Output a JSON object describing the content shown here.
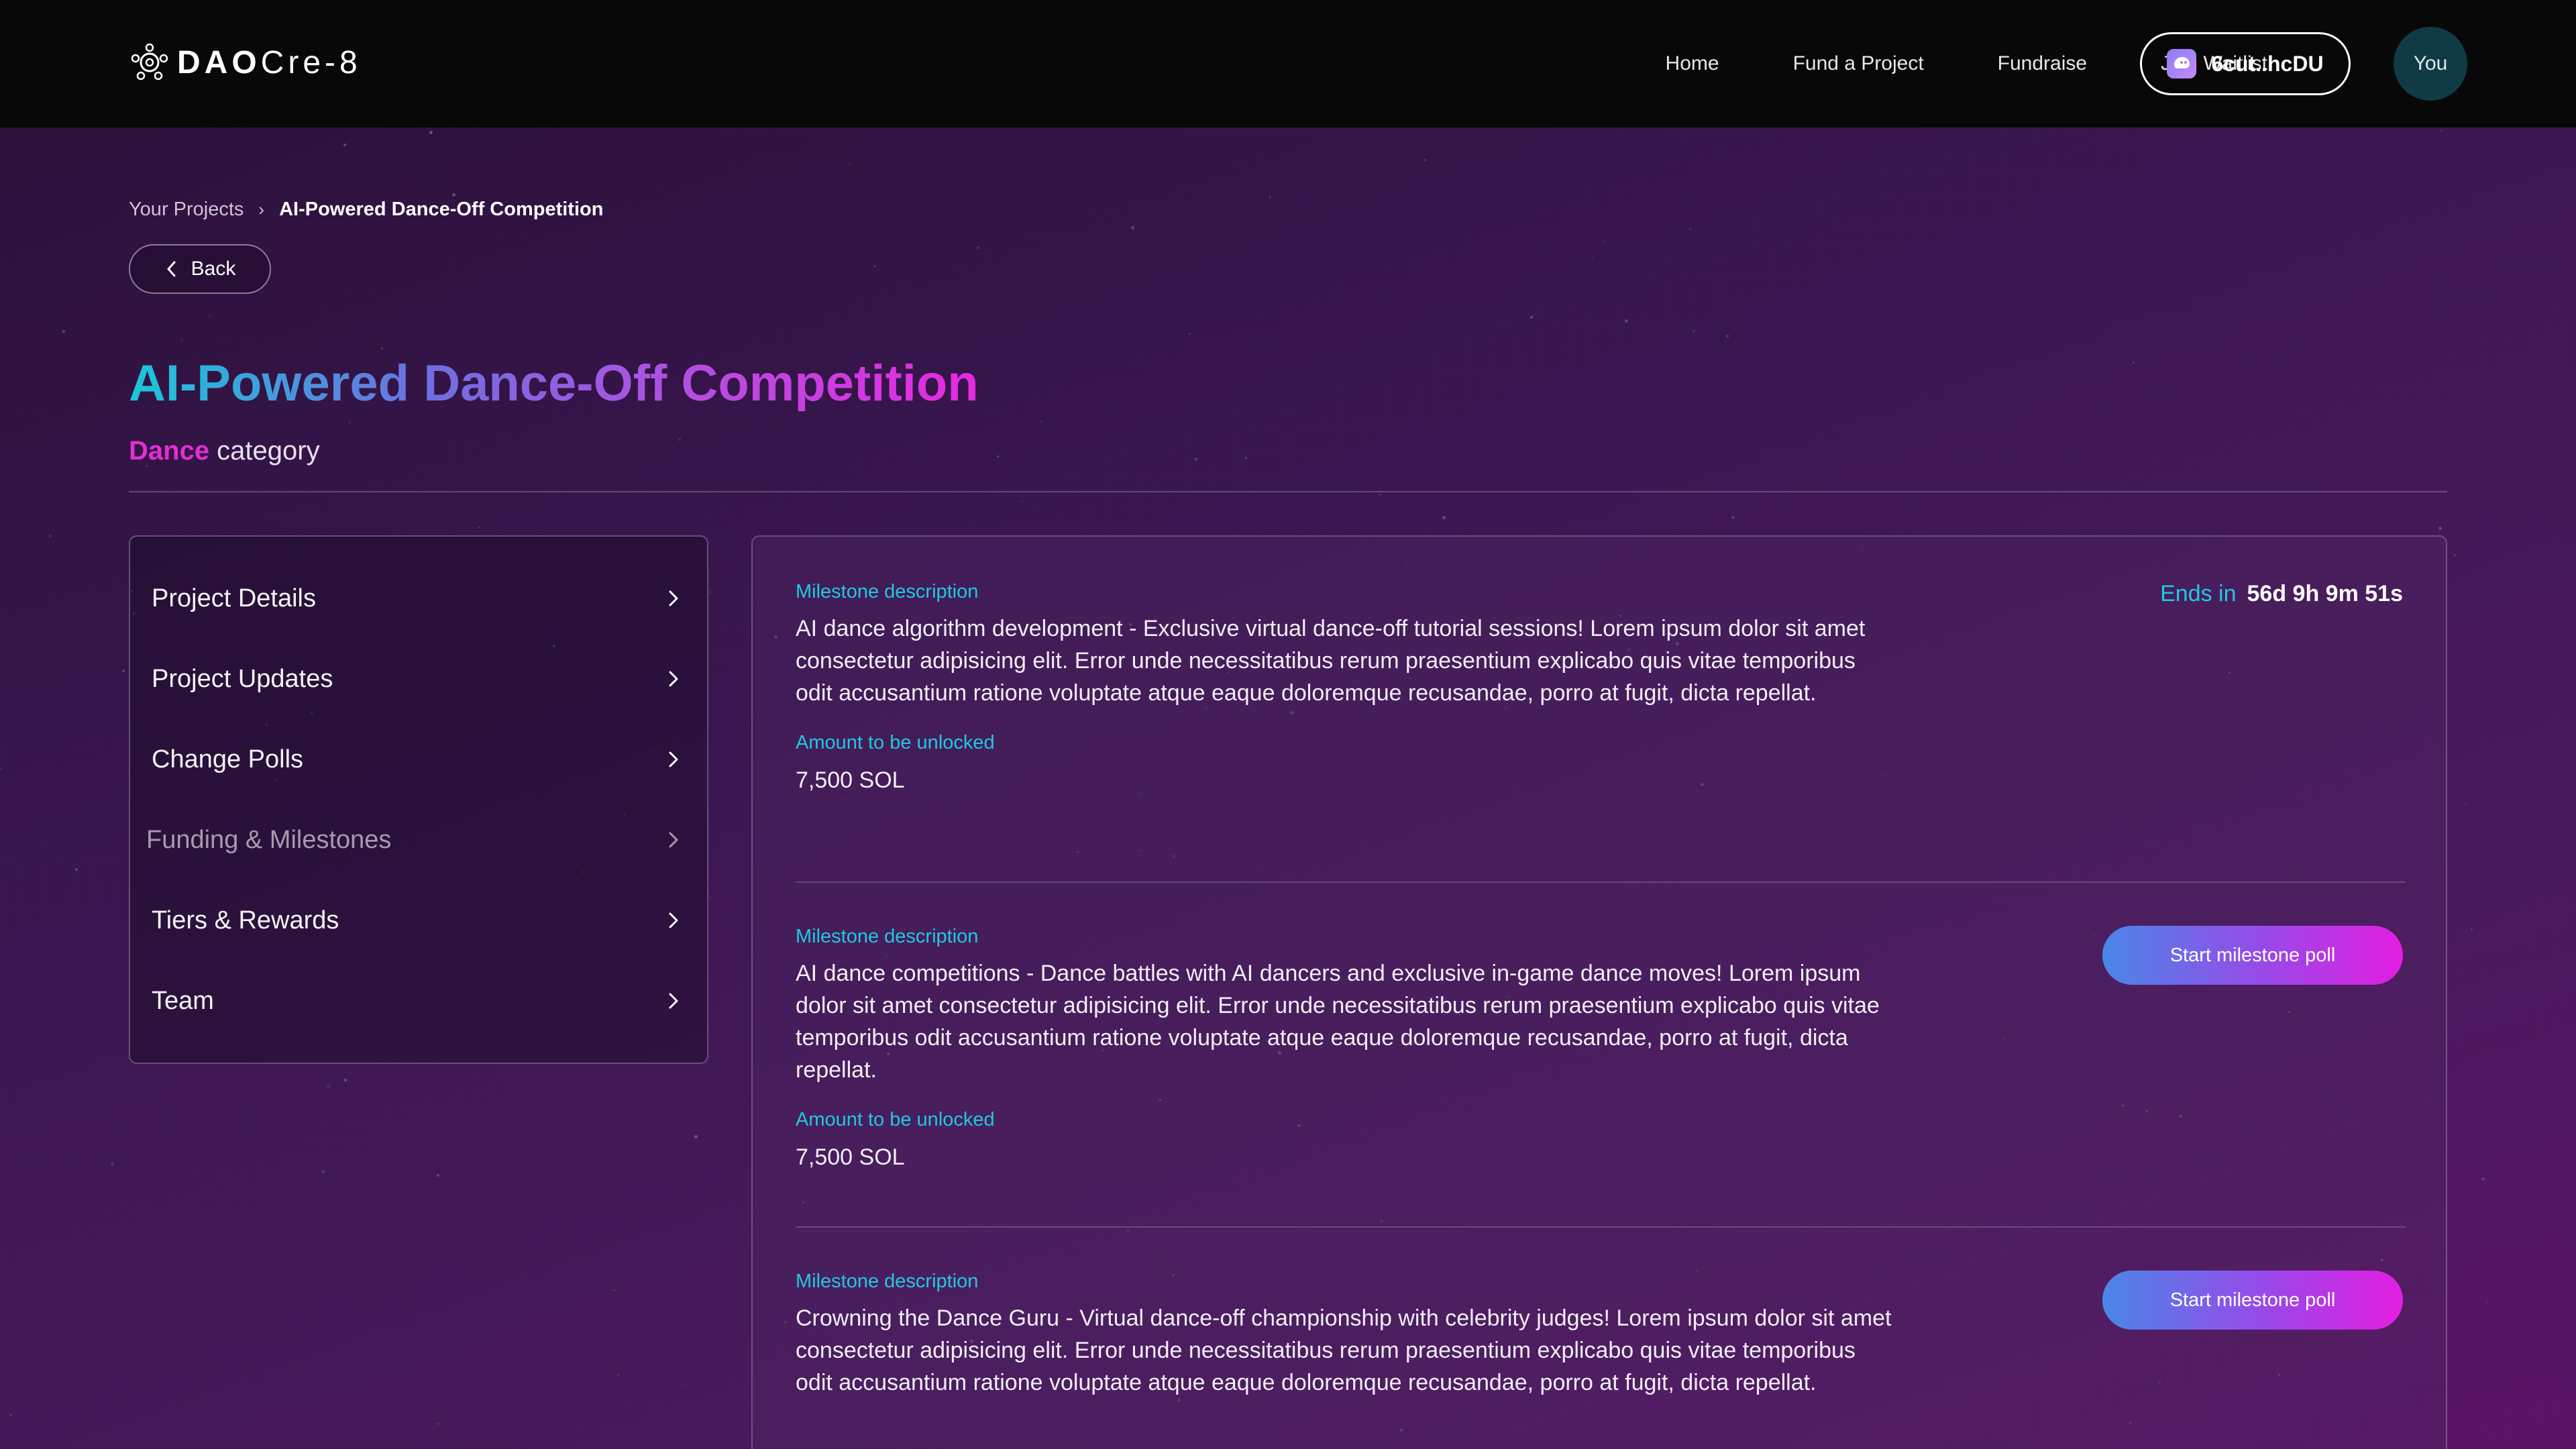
{
  "header": {
    "logo_text_bold": "DAO",
    "logo_text_light": "Cre-8",
    "nav": [
      {
        "label": "Home"
      },
      {
        "label": "Fund a Project"
      },
      {
        "label": "Fundraise"
      },
      {
        "label": "Join Waitlist"
      }
    ],
    "wallet_address": "6cut..hcDU",
    "avatar_label": "You"
  },
  "breadcrumb": {
    "parent": "Your Projects",
    "separator": "›",
    "current": "AI-Powered Dance-Off Competition"
  },
  "back_label": "Back",
  "project": {
    "title": "AI-Powered Dance-Off Competition",
    "category_name": "Dance",
    "category_suffix": " category"
  },
  "sidebar": {
    "items": [
      {
        "label": "Project Details"
      },
      {
        "label": "Project Updates"
      },
      {
        "label": "Change Polls"
      },
      {
        "label": "Funding & Milestones"
      },
      {
        "label": "Tiers & Rewards"
      },
      {
        "label": "Team"
      }
    ]
  },
  "milestones": {
    "ends_label": "Ends in",
    "ends_value": "56d 9h 9m 51s",
    "poll_button_label": "Start milestone poll",
    "items": [
      {
        "description_label": "Milestone description",
        "description": "AI dance algorithm development - Exclusive virtual dance-off tutorial sessions! Lorem ipsum dolor sit amet consectetur adipisicing elit. Error unde necessitatibus rerum praesentium explicabo quis vitae temporibus odit accusantium ratione voluptate atque eaque doloremque recusandae, porro at fugit, dicta repellat.",
        "amount_label": "Amount to be unlocked",
        "amount": "7,500 SOL"
      },
      {
        "description_label": "Milestone description",
        "description": "AI dance competitions - Dance battles with AI dancers and exclusive in-game dance moves! Lorem ipsum dolor sit amet consectetur adipisicing elit. Error unde necessitatibus rerum praesentium explicabo quis vitae temporibus odit accusantium ratione voluptate atque eaque doloremque recusandae, porro at fugit, dicta repellat.",
        "amount_label": "Amount to be unlocked",
        "amount": "7,500 SOL"
      },
      {
        "description_label": "Milestone description",
        "description": "Crowning the Dance Guru - Virtual dance-off championship with celebrity judges! Lorem ipsum dolor sit amet consectetur adipisicing elit. Error unde necessitatibus rerum praesentium explicabo quis vitae temporibus odit accusantium ratione voluptate atque eaque doloremque recusandae, porro at fugit, dicta repellat."
      }
    ]
  },
  "colors": {
    "accent_cyan": "#20c8e0",
    "accent_magenta": "#e02fd3",
    "header_bg": "#080808"
  }
}
